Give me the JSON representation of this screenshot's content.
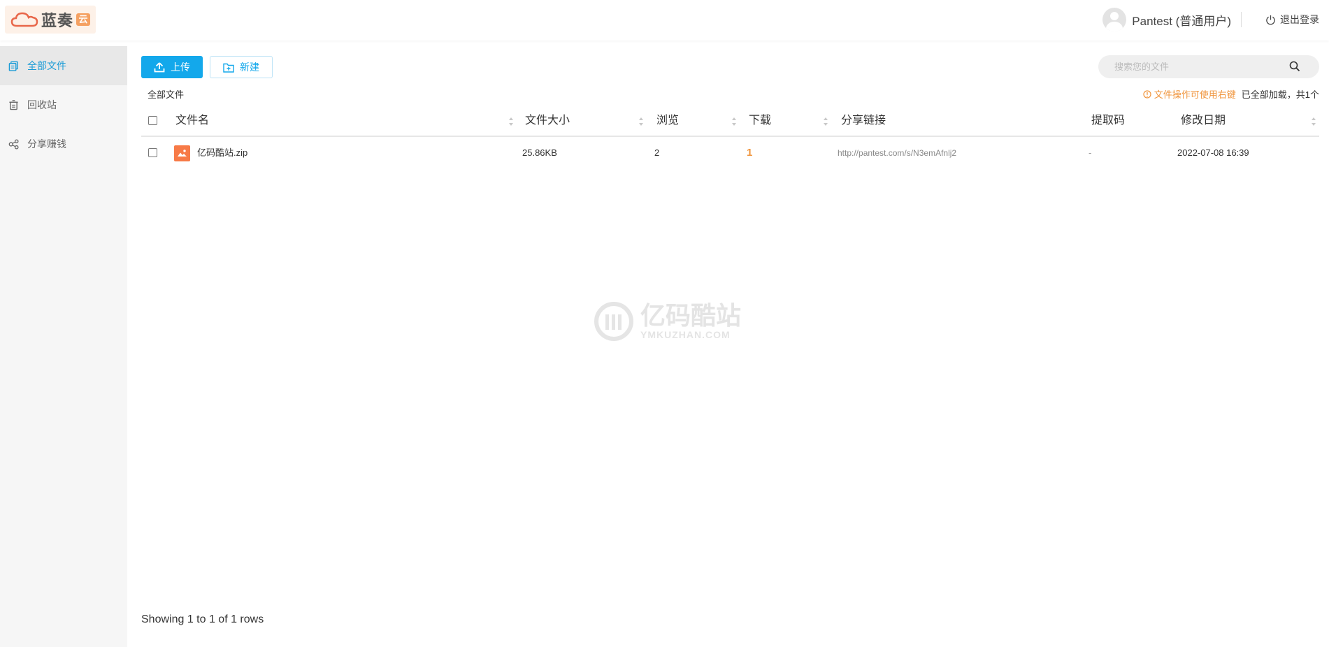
{
  "header": {
    "logo_text": "蓝奏",
    "logo_badge": "云",
    "user_name": "Pantest (普通用户)",
    "logout_label": "退出登录"
  },
  "sidebar": {
    "items": [
      {
        "label": "全部文件",
        "icon": "files-icon",
        "active": true
      },
      {
        "label": "回收站",
        "icon": "trash-icon",
        "active": false
      },
      {
        "label": "分享赚钱",
        "icon": "share-icon",
        "active": false
      }
    ]
  },
  "toolbar": {
    "upload_label": "上传",
    "new_label": "新建",
    "search_placeholder": "搜索您的文件"
  },
  "breadcrumb": "全部文件",
  "hint": {
    "warning": "文件操作可使用右键",
    "count": "已全部加载，共1个"
  },
  "table": {
    "columns": [
      "文件名",
      "文件大小",
      "浏览",
      "下载",
      "分享链接",
      "提取码",
      "修改日期"
    ],
    "rows": [
      {
        "name": "亿码酷站.zip",
        "size": "25.86KB",
        "views": "2",
        "downloads": "1",
        "link": "http://pantest.com/s/N3emAfnlj2",
        "code": "-",
        "date": "2022-07-08 16:39"
      }
    ]
  },
  "footer": "Showing 1 to 1 of 1 rows",
  "watermark": {
    "cn": "亿码酷站",
    "en": "YMKUZHAN.COM"
  },
  "colors": {
    "accent": "#13a8eb",
    "warning": "#f0953d",
    "file_icon": "#f77a47"
  }
}
